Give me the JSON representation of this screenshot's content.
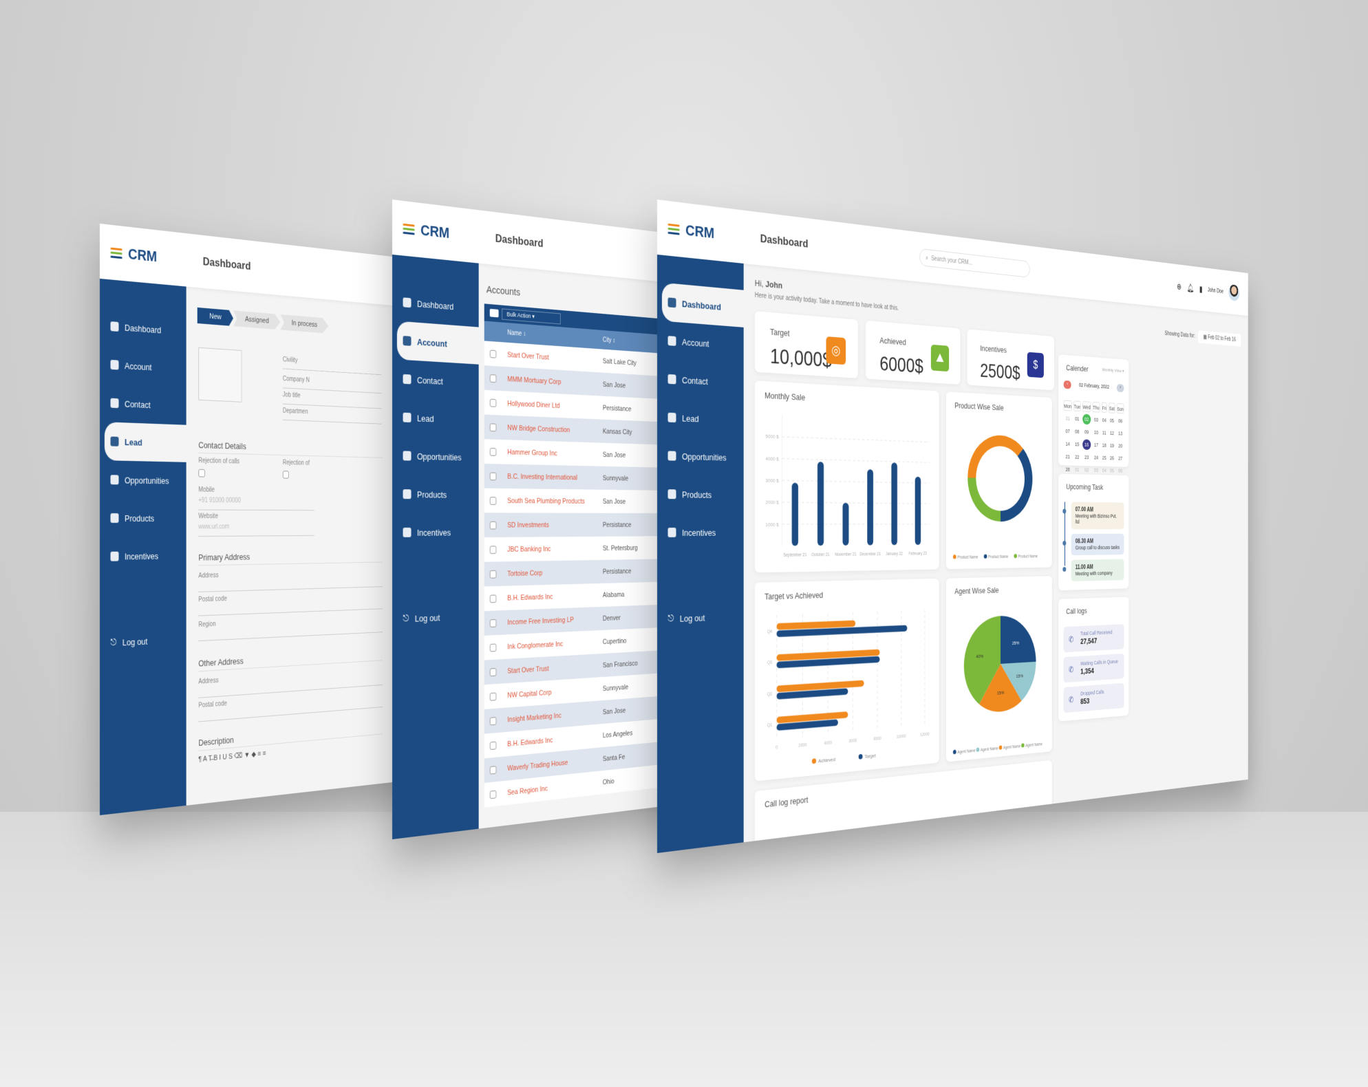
{
  "brand": {
    "name": "CRM",
    "stripe_colors": [
      "#f0891e",
      "#7cb83a",
      "#1b4b82"
    ]
  },
  "colors": {
    "primary": "#1b4b82",
    "orange": "#f0891e",
    "green": "#7cb83a",
    "navy": "#283593",
    "teal": "#95c8cf",
    "link_red": "#e0553a"
  },
  "screens": {
    "lead": {
      "header_title": "Dashboard",
      "nav": [
        {
          "label": "Dashboard",
          "icon": "grid-icon"
        },
        {
          "label": "Account",
          "icon": "users-icon"
        },
        {
          "label": "Contact",
          "icon": "user-icon"
        },
        {
          "label": "Lead",
          "icon": "lead-icon",
          "active": true
        },
        {
          "label": "Opportunities",
          "icon": "globe-icon"
        },
        {
          "label": "Products",
          "icon": "box-icon"
        },
        {
          "label": "Incentives",
          "icon": "receipt-icon"
        }
      ],
      "logout": "Log out",
      "steps": [
        "New",
        "Assigned",
        "In process"
      ],
      "right_fields": [
        "Civility",
        "Company N",
        "Job title",
        "Departmen"
      ],
      "contact_details": "Contact Details",
      "rejection_calls": "Rejection of calls",
      "rejection_other": "Rejection of",
      "mobile_label": "Mobile",
      "mobile_placeholder": "+91 91000 00000",
      "website_label": "Website",
      "website_placeholder": "www.url.com",
      "primary_address": "Primary Address",
      "primary_fields": [
        "Address",
        "Postal code",
        "Region"
      ],
      "other_address": "Other Address",
      "other_fields": [
        "Address",
        "Postal code"
      ],
      "description": "Description",
      "editor_toolbar": "¶ A T̶  B I U S ⌫  ▼ ◆  ≡ ≡"
    },
    "accounts": {
      "header_title": "Dashboard",
      "page_title": "Accounts",
      "nav": [
        {
          "label": "Dashboard"
        },
        {
          "label": "Account",
          "active": true
        },
        {
          "label": "Contact"
        },
        {
          "label": "Lead"
        },
        {
          "label": "Opportunities"
        },
        {
          "label": "Products"
        },
        {
          "label": "Incentives"
        }
      ],
      "logout": "Log out",
      "bulk_action": "Bulk Action ▾",
      "columns": [
        "Name ↕",
        "City ↕"
      ],
      "rows": [
        [
          "Start Over Trust",
          "Salt Lake City"
        ],
        [
          "MMM Mortuary Corp",
          "San Jose"
        ],
        [
          "Hollywood Diner Ltd",
          "Persistance"
        ],
        [
          "NW Bridge Construction",
          "Kansas City"
        ],
        [
          "Hammer Group Inc",
          "San Jose"
        ],
        [
          "B.C. Investing International",
          "Sunnyvale"
        ],
        [
          "South Sea Plumbing Products",
          "San Jose"
        ],
        [
          "SD Investments",
          "Persistance"
        ],
        [
          "JBC Banking Inc",
          "St. Petersburg"
        ],
        [
          "Tortoise Corp",
          "Persistance"
        ],
        [
          "B.H. Edwards Inc",
          "Alabama"
        ],
        [
          "Income Free Investing LP",
          "Denver"
        ],
        [
          "Ink Conglomerate Inc",
          "Cupertino"
        ],
        [
          "Start Over Trust",
          "San Francisco"
        ],
        [
          "NW Capital Corp",
          "Sunnyvale"
        ],
        [
          "Insight Marketing Inc",
          "San Jose"
        ],
        [
          "B.H. Edwards Inc",
          "Los Angeles"
        ],
        [
          "Waverly Trading House",
          "Santa Fe"
        ],
        [
          "Sea Region Inc",
          "Ohio"
        ]
      ]
    },
    "dashboard": {
      "header_title": "Dashboard",
      "search_placeholder": "Search your CRM...",
      "user_name": "John Doe",
      "nav": [
        {
          "label": "Dashboard",
          "active": true
        },
        {
          "label": "Account"
        },
        {
          "label": "Contact"
        },
        {
          "label": "Lead"
        },
        {
          "label": "Opportunities"
        },
        {
          "label": "Products"
        },
        {
          "label": "Incentives"
        }
      ],
      "logout": "Log out",
      "greeting_hi": "Hi,",
      "greeting_name": "John",
      "subtitle": "Here is your activity today. Take a moment to have look at this.",
      "showing_label": "Showing Data for:",
      "date_range": "Feb 02 to Feb 16",
      "kpis": [
        {
          "label": "Target",
          "value": "10,000$",
          "icon": "target-icon",
          "color": "#f0891e"
        },
        {
          "label": "Achieved",
          "value": "6000$",
          "icon": "mountain-flag-icon",
          "color": "#7cb83a"
        },
        {
          "label": "Incentives",
          "value": "2500$",
          "icon": "money-bag-icon",
          "color": "#283593"
        }
      ],
      "calendar": {
        "title": "Calender",
        "view": "Monthly View ▾",
        "month": "02 February, 2022",
        "weekdays": [
          "Mon",
          "Tue",
          "Wed",
          "Thu",
          "Fri",
          "Sat",
          "Sun"
        ],
        "days": [
          "31",
          "01",
          "02",
          "03",
          "04",
          "05",
          "06",
          "07",
          "08",
          "09",
          "10",
          "11",
          "12",
          "13",
          "14",
          "15",
          "16",
          "17",
          "18",
          "19",
          "20",
          "21",
          "22",
          "23",
          "24",
          "25",
          "26",
          "27",
          "28",
          "01",
          "02",
          "03",
          "04",
          "05",
          "06"
        ],
        "today": "02",
        "selected": "16"
      },
      "upcoming": {
        "title": "Upcoming Task",
        "tasks": [
          {
            "time": "07.00 AM",
            "text": "Meeting with Bizinso Pvt. ltd",
            "color": "#f6f1e4"
          },
          {
            "time": "08.30 AM",
            "text": "Group call to discuss tasks",
            "color": "#e2eaf6"
          },
          {
            "time": "11.00 AM",
            "text": "Meeting with company",
            "color": "#e6f2e8"
          }
        ]
      },
      "call_logs": {
        "title": "Call logs",
        "items": [
          {
            "label": "Total Call Received",
            "value": "27,547"
          },
          {
            "label": "Waiting Calls in Queue",
            "value": "1,354"
          },
          {
            "label": "Dropped Calls",
            "value": "853"
          }
        ]
      },
      "call_log_report": "Call log report"
    }
  },
  "chart_data": [
    {
      "type": "bar",
      "title": "Monthly Sale",
      "categories": [
        "September 21",
        "October 21",
        "November 21",
        "December 21",
        "January 22",
        "February 22"
      ],
      "values": [
        2900,
        3900,
        2000,
        3600,
        3950,
        3300
      ],
      "yticks": [
        "1000 $",
        "2000 $",
        "3000 $",
        "4000 $",
        "5000 $"
      ],
      "ylim": [
        0,
        6000
      ],
      "grid": true
    },
    {
      "type": "pie",
      "variant": "donut",
      "title": "Product Wise Sale",
      "series": [
        {
          "name": "Product Name",
          "value": 37.5,
          "color": "#f0891e"
        },
        {
          "name": "Product Name",
          "value": 25,
          "color": "#7cb83a"
        },
        {
          "name": "Product Name",
          "value": 37.5,
          "color": "#1b4b82"
        }
      ],
      "legend": "bottom"
    },
    {
      "type": "bar",
      "orientation": "horizontal",
      "title": "Target vs Achieved",
      "categories": [
        "Q1",
        "Q2",
        "Q3",
        "Q4"
      ],
      "series": [
        {
          "name": "Achieved",
          "values": [
            5600,
            6900,
            8200,
            6200
          ],
          "color": "#f0891e"
        },
        {
          "name": "Target",
          "values": [
            4800,
            5600,
            8200,
            10500
          ],
          "color": "#1b4b82"
        }
      ],
      "xticks": [
        "0",
        "2000",
        "4000",
        "6000",
        "8000",
        "10000",
        "12000"
      ],
      "xlim": [
        0,
        12000
      ],
      "legend": "bottom"
    },
    {
      "type": "pie",
      "title": "Agent Wise Sale",
      "series": [
        {
          "name": "Agent Name",
          "value": 25,
          "label": "25%",
          "color": "#1b4b82"
        },
        {
          "name": "Agent Name",
          "value": 15,
          "label": "15%",
          "color": "#95c8cf"
        },
        {
          "name": "Agent Name",
          "value": 20,
          "label": "15%",
          "color": "#f0891e"
        },
        {
          "name": "Agent Name",
          "value": 40,
          "label": "40%",
          "color": "#7cb83a"
        }
      ],
      "legend": "bottom"
    }
  ]
}
